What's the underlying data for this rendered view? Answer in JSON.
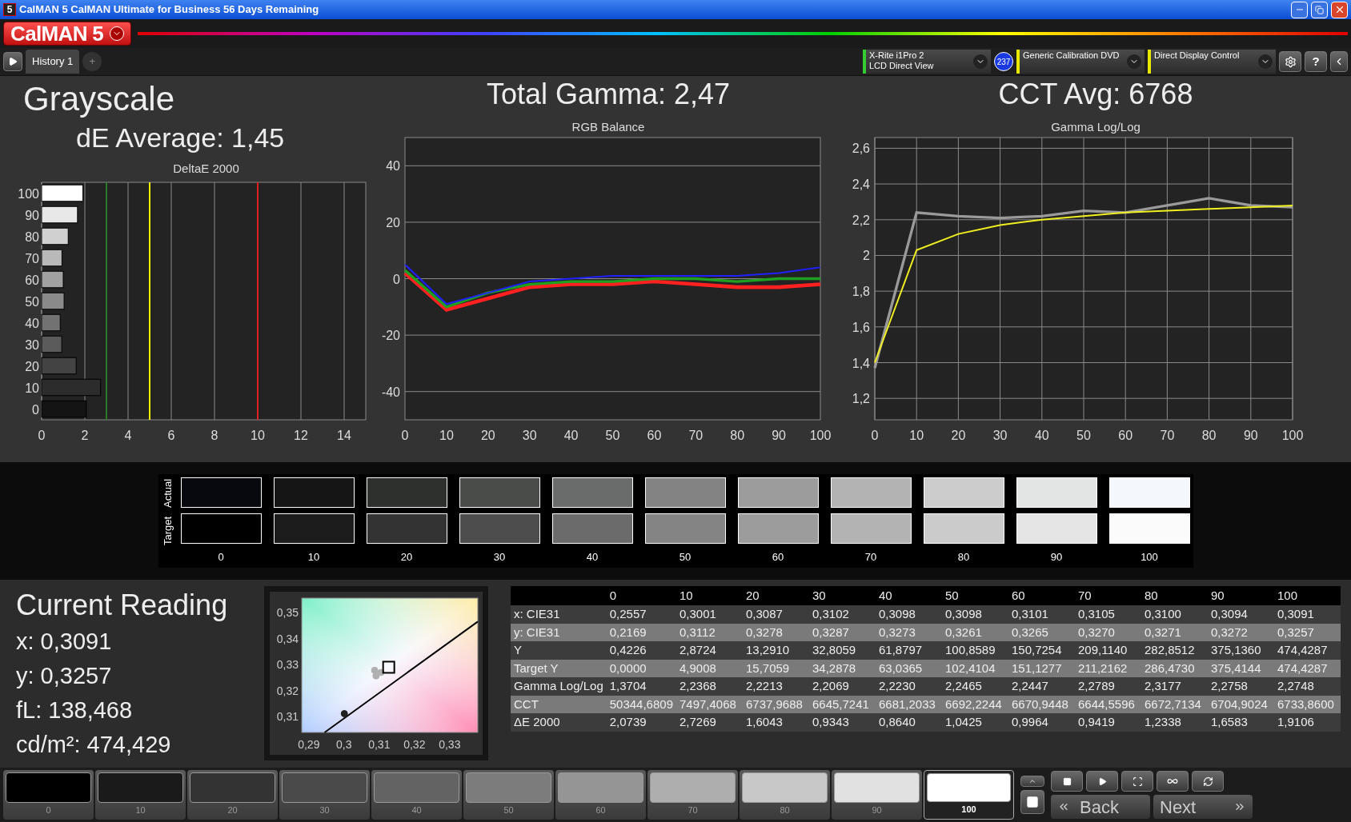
{
  "window": {
    "icon_label": "5",
    "title": "CalMAN 5 CalMAN Ultimate for Business 56 Days Remaining"
  },
  "logo": "CalMAN 5",
  "tabs": [
    {
      "label": "History 1",
      "selected": true
    }
  ],
  "add_tab": "+",
  "devices": [
    {
      "lines": [
        "X-Rite i1Pro 2",
        "LCD Direct View"
      ],
      "color": "#33cc33"
    },
    {
      "lines": [
        "Generic Calibration DVD"
      ],
      "color": "#e8e800"
    },
    {
      "lines": [
        "Direct Display Control"
      ],
      "color": "#e8e800"
    }
  ],
  "device_badge": "237",
  "help": "?",
  "panel": {
    "title": "Grayscale",
    "de_average": "dE Average: 1,45",
    "total_gamma": "Total Gamma: 2,47",
    "cct_avg": "CCT Avg: 6768"
  },
  "deltae_chart": {
    "chart_data": {
      "type": "bar",
      "orientation": "horizontal",
      "title": "DeltaE 2000",
      "categories": [
        "100",
        "90",
        "80",
        "70",
        "60",
        "50",
        "40",
        "30",
        "20",
        "10",
        "0"
      ],
      "values": [
        1.91,
        1.66,
        1.23,
        0.94,
        1.0,
        1.04,
        0.86,
        0.93,
        1.6,
        2.73,
        2.07
      ],
      "xlim": [
        0,
        15
      ],
      "xticks": [
        0,
        2,
        4,
        6,
        8,
        10,
        12,
        14
      ],
      "grid": true,
      "ref_lines": [
        {
          "axis": "x",
          "value": 3,
          "color": "#2a7a2a"
        },
        {
          "axis": "x",
          "value": 5,
          "color": "#f0f000"
        },
        {
          "axis": "x",
          "value": 10,
          "color": "#e02020"
        }
      ]
    }
  },
  "rgb_chart": {
    "chart_data": {
      "type": "line",
      "title": "RGB Balance",
      "x": [
        0,
        10,
        20,
        30,
        40,
        50,
        60,
        70,
        80,
        90,
        100
      ],
      "xlim": [
        0,
        100
      ],
      "ylim": [
        -50,
        50
      ],
      "xticks": [
        0,
        10,
        20,
        30,
        40,
        50,
        60,
        70,
        80,
        90,
        100
      ],
      "yticks": [
        -40,
        -20,
        0,
        20,
        40
      ],
      "grid": true,
      "series": [
        {
          "color": "#ff2020",
          "values": [
            2,
            -11,
            -7,
            -3,
            -2,
            -2,
            -1,
            -2,
            -3,
            -3,
            -2
          ]
        },
        {
          "color": "#20a020",
          "values": [
            3,
            -10,
            -5,
            -2,
            -1,
            -1,
            0,
            0,
            -1,
            0,
            0
          ]
        },
        {
          "color": "#2020ff",
          "values": [
            5,
            -9,
            -5,
            -1,
            0,
            1,
            1,
            1,
            1,
            2,
            4
          ]
        }
      ]
    }
  },
  "gamma_chart": {
    "chart_data": {
      "type": "line",
      "title": "Gamma Log/Log",
      "x": [
        0,
        10,
        20,
        30,
        40,
        50,
        60,
        70,
        80,
        90,
        100
      ],
      "xlim": [
        0,
        100
      ],
      "ylim": [
        1.08,
        2.66
      ],
      "xticks": [
        0,
        10,
        20,
        30,
        40,
        50,
        60,
        70,
        80,
        90,
        100
      ],
      "yticks": [
        {
          "value": 1.2,
          "label": "1,2"
        },
        {
          "value": 1.4,
          "label": "1,4"
        },
        {
          "value": 1.6,
          "label": "1,6"
        },
        {
          "value": 1.8,
          "label": "1,8"
        },
        {
          "value": 2,
          "label": "2"
        },
        {
          "value": 2.2,
          "label": "2,2"
        },
        {
          "value": 2.4,
          "label": "2,4"
        },
        {
          "value": 2.6,
          "label": "2,6"
        }
      ],
      "grid": true,
      "series": [
        {
          "color": "#9a9a9a",
          "values": [
            1.37,
            2.24,
            2.22,
            2.21,
            2.22,
            2.25,
            2.24,
            2.28,
            2.32,
            2.28,
            2.27
          ]
        },
        {
          "color": "#f0f020",
          "values": [
            1.4,
            2.03,
            2.12,
            2.17,
            2.2,
            2.22,
            2.24,
            2.25,
            2.26,
            2.27,
            2.28
          ]
        }
      ]
    }
  },
  "swatches": {
    "columns": [
      "0",
      "10",
      "20",
      "30",
      "40",
      "50",
      "60",
      "70",
      "80",
      "90",
      "100"
    ],
    "rows": [
      {
        "label": "Actual",
        "cells": [
          {
            "color": "#08080f"
          },
          {
            "color": "#151515"
          },
          {
            "color": "#2e302e"
          },
          {
            "color": "#4a4c4a"
          },
          {
            "color": "#6a6b6b"
          },
          {
            "color": "#838383"
          },
          {
            "color": "#9c9c9c"
          },
          {
            "color": "#b3b3b3"
          },
          {
            "color": "#cccccc"
          },
          {
            "color": "#e2e5e4"
          },
          {
            "color": "#f4f8fc"
          }
        ]
      },
      {
        "label": "Target",
        "cells": [
          {
            "color": "#000000"
          },
          {
            "color": "#1c1c1c"
          },
          {
            "color": "#333333"
          },
          {
            "color": "#4d4d4d"
          },
          {
            "color": "#6b6b6b"
          },
          {
            "color": "#848484"
          },
          {
            "color": "#9c9c9c"
          },
          {
            "color": "#b3b3b3"
          },
          {
            "color": "#cbcbcb"
          },
          {
            "color": "#e5e5e5"
          },
          {
            "color": "#fbfbfb"
          }
        ]
      }
    ]
  },
  "current_reading": {
    "title": "Current Reading",
    "lines": [
      "x: 0,3091",
      "y: 0,3257",
      "fL: 138,468",
      "cd/m²: 474,429"
    ]
  },
  "chromaticity_chart": {
    "chart_data": {
      "type": "scatter",
      "xlim": [
        0.288,
        0.338
      ],
      "ylim": [
        0.304,
        0.3555
      ],
      "xticks": [
        {
          "value": 0.29,
          "label": "0,29"
        },
        {
          "value": 0.3,
          "label": "0,3"
        },
        {
          "value": 0.31,
          "label": "0,31"
        },
        {
          "value": 0.32,
          "label": "0,32"
        },
        {
          "value": 0.33,
          "label": "0,33"
        }
      ],
      "yticks": [
        {
          "value": 0.31,
          "label": "0,31"
        },
        {
          "value": 0.32,
          "label": "0,32"
        },
        {
          "value": 0.33,
          "label": "0,33"
        },
        {
          "value": 0.34,
          "label": "0,34"
        },
        {
          "value": 0.35,
          "label": "0,35"
        }
      ],
      "series": [
        {
          "type": "line",
          "color": "#000000",
          "x": [
            0.2945,
            0.338
          ],
          "values": [
            0.304,
            0.3465
          ]
        },
        {
          "type": "scatter",
          "marker": "o",
          "color": "#202020",
          "x": [
            0.3001
          ],
          "values": [
            0.3112
          ]
        },
        {
          "type": "scatter",
          "marker": "o",
          "color": "#b0b0b0",
          "x": [
            0.3087,
            0.3105,
            0.3091
          ],
          "values": [
            0.3278,
            0.327,
            0.3257
          ]
        },
        {
          "type": "scatter",
          "marker": "s",
          "color": "#000000",
          "x": [
            0.3127
          ],
          "values": [
            0.329
          ]
        }
      ]
    }
  },
  "table": {
    "columns": [
      "0",
      "10",
      "20",
      "30",
      "40",
      "50",
      "60",
      "70",
      "80",
      "90",
      "100"
    ],
    "rows": [
      {
        "label": "x: CIE31",
        "cells": [
          "0,2557",
          "0,3001",
          "0,3087",
          "0,3102",
          "0,3098",
          "0,3098",
          "0,3101",
          "0,3105",
          "0,3100",
          "0,3094",
          "0,3091"
        ]
      },
      {
        "label": "y: CIE31",
        "cells": [
          "0,2169",
          "0,3112",
          "0,3278",
          "0,3287",
          "0,3273",
          "0,3261",
          "0,3265",
          "0,3270",
          "0,3271",
          "0,3272",
          "0,3257"
        ]
      },
      {
        "label": "Y",
        "cells": [
          "0,4226",
          "2,8724",
          "13,2910",
          "32,8059",
          "61,8797",
          "100,8589",
          "150,7254",
          "209,1140",
          "282,8512",
          "375,1360",
          "474,4287"
        ]
      },
      {
        "label": "Target Y",
        "cells": [
          "0,0000",
          "4,9008",
          "15,7059",
          "34,2878",
          "63,0365",
          "102,4104",
          "151,1277",
          "211,2162",
          "286,4730",
          "375,4144",
          "474,4287"
        ]
      },
      {
        "label": "Gamma Log/Log",
        "cells": [
          "1,3704",
          "2,2368",
          "2,2213",
          "2,2069",
          "2,2230",
          "2,2465",
          "2,2447",
          "2,2789",
          "2,3177",
          "2,2758",
          "2,2748"
        ]
      },
      {
        "label": "CCT",
        "cells": [
          "50344,6809",
          "7497,4068",
          "6737,9688",
          "6645,7241",
          "6681,2033",
          "6692,2244",
          "6670,9448",
          "6644,5596",
          "6672,7134",
          "6704,9024",
          "6733,8600"
        ]
      },
      {
        "label": "ΔE 2000",
        "cells": [
          "2,0739",
          "2,7269",
          "1,6043",
          "0,9343",
          "0,8640",
          "1,0425",
          "0,9964",
          "0,9419",
          "1,2338",
          "1,6583",
          "1,9106"
        ]
      }
    ]
  },
  "patches": [
    {
      "label": "0",
      "color": "#000000",
      "selected": false
    },
    {
      "label": "10",
      "color": "#1a1a1a",
      "selected": false
    },
    {
      "label": "20",
      "color": "#333333",
      "selected": false
    },
    {
      "label": "30",
      "color": "#4a4a4a",
      "selected": false
    },
    {
      "label": "40",
      "color": "#636363",
      "selected": false
    },
    {
      "label": "50",
      "color": "#7c7c7c",
      "selected": false
    },
    {
      "label": "60",
      "color": "#959595",
      "selected": false
    },
    {
      "label": "70",
      "color": "#aeaeae",
      "selected": false
    },
    {
      "label": "80",
      "color": "#c8c8c8",
      "selected": false
    },
    {
      "label": "90",
      "color": "#e1e1e1",
      "selected": false
    },
    {
      "label": "100",
      "color": "#ffffff",
      "selected": true
    }
  ],
  "nav": {
    "back": "Back",
    "next": "Next"
  }
}
